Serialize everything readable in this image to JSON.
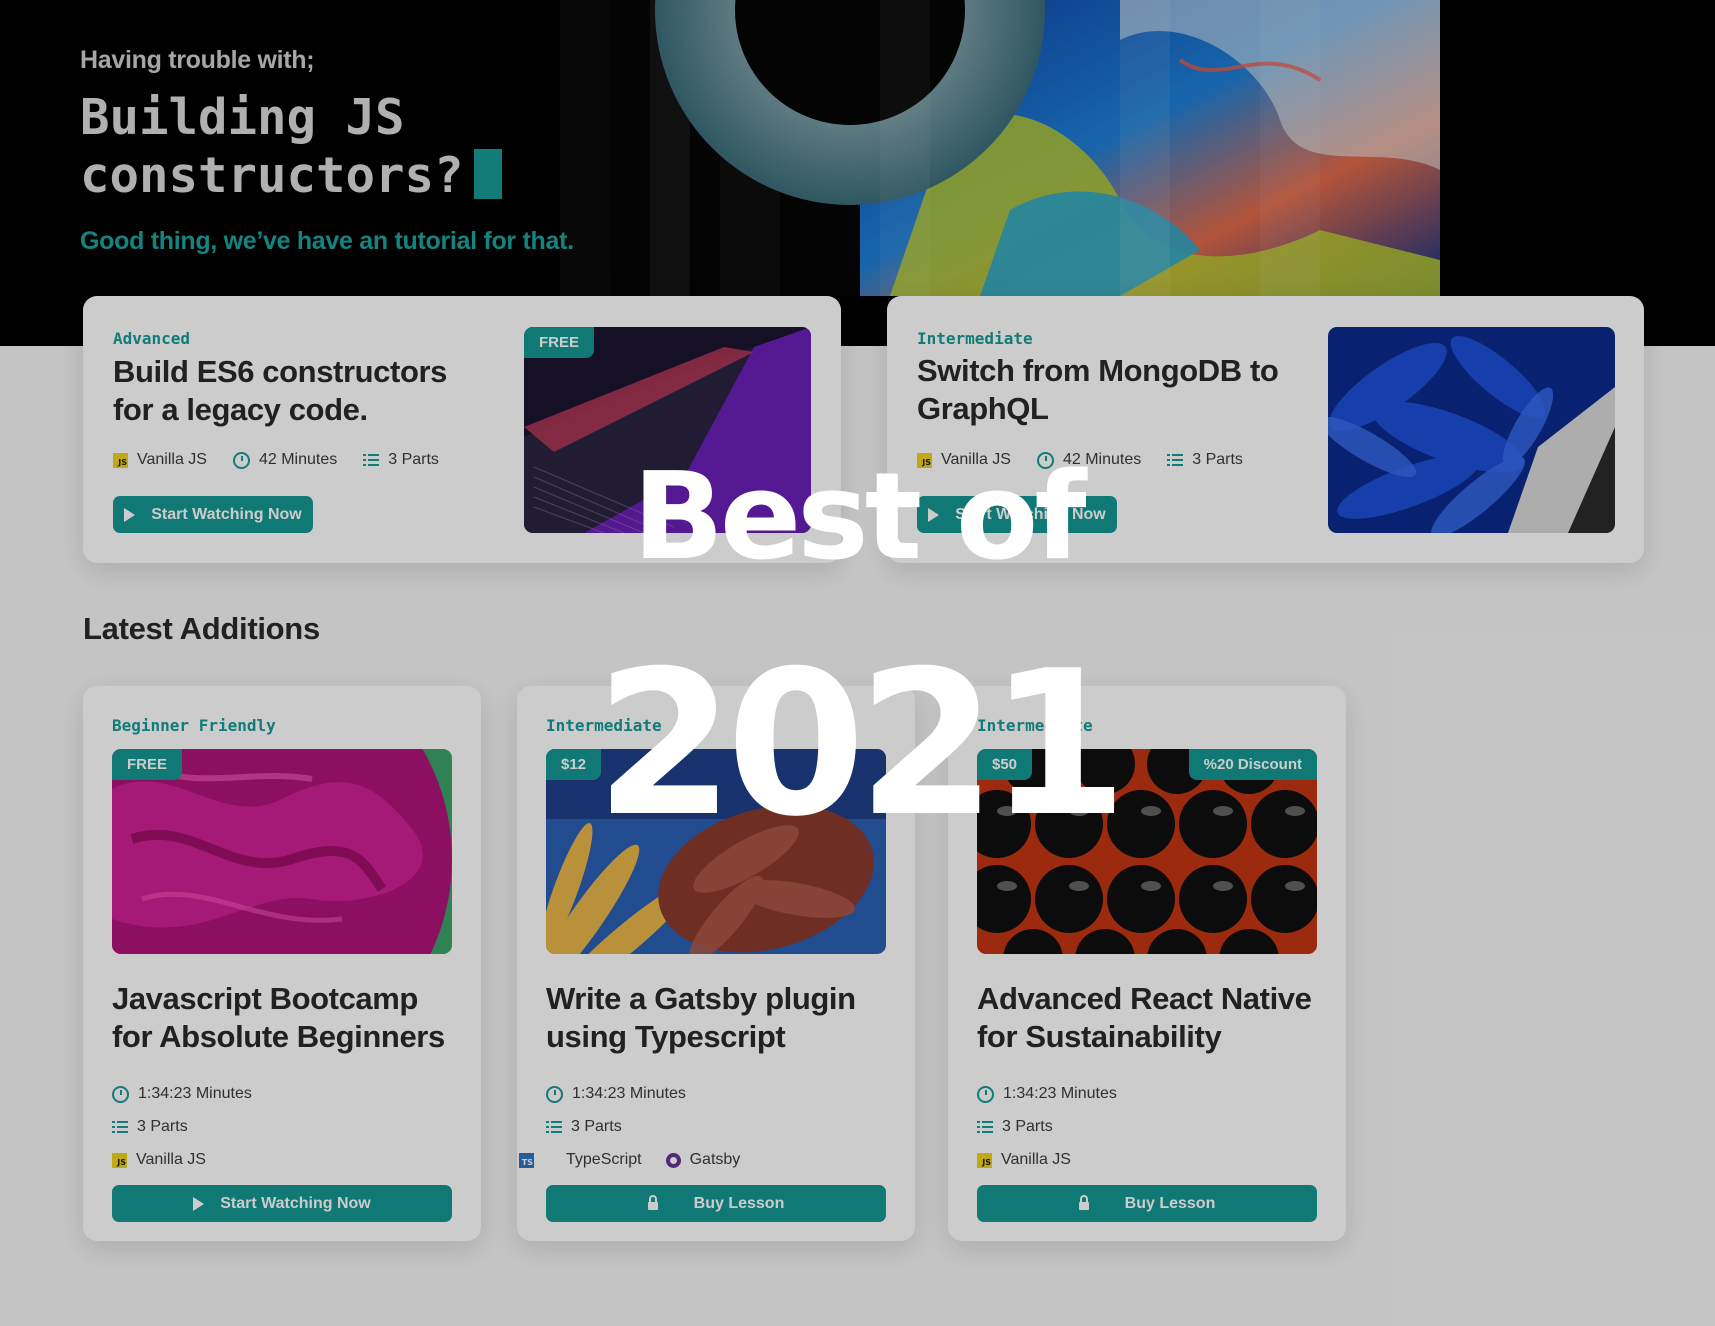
{
  "hero": {
    "subtitle": "Having trouble with;",
    "title_line1": "Building JS",
    "title_line2": "constructors?",
    "tagline": "Good thing, we’ve have an tutorial for that."
  },
  "featured": [
    {
      "level": "Advanced",
      "title_line1": "Build ES6 constructors",
      "title_line2": "for a legacy code.",
      "tech": "Vanilla JS",
      "duration": "42 Minutes",
      "parts": "3 Parts",
      "badge": "FREE",
      "button": "Start Watching Now"
    },
    {
      "level": "Intermediate",
      "title_line1": "Switch from MongoDB to",
      "title_line2": "GraphQL",
      "tech": "Vanilla JS",
      "duration": "42 Minutes",
      "parts": "3 Parts",
      "button": "Start Watching Now"
    }
  ],
  "latest": {
    "heading": "Latest Additions",
    "cards": [
      {
        "level": "Beginner Friendly",
        "badge_left": "FREE",
        "title_line1": "Javascript Bootcamp",
        "title_line2": "for Absolute Beginners",
        "duration": "1:34:23 Minutes",
        "parts": "3 Parts",
        "tech": "Vanilla JS",
        "button": "Start Watching Now"
      },
      {
        "level": "Intermediate",
        "badge_left": "$12",
        "title_line1": "Write a Gatsby plugin",
        "title_line2": "using Typescript",
        "duration": "1:34:23 Minutes",
        "parts": "3 Parts",
        "tech": "TypeScript",
        "tech2": "Gatsby",
        "button": "Buy Lesson"
      },
      {
        "level": "Intermediate",
        "badge_left": "$50",
        "badge_right": "%20 Discount",
        "title_line1": "Advanced React Native",
        "title_line2": "for Sustainability",
        "duration": "1:34:23 Minutes",
        "parts": "3 Parts",
        "tech": "Vanilla JS",
        "button": "Buy Lesson"
      }
    ]
  },
  "overlay": {
    "line1": "Best of",
    "line2": "2021"
  },
  "icons": {
    "js": "JS",
    "ts": "TS"
  },
  "colors": {
    "accent": "#169893",
    "hero_bg": "#000000",
    "page_bg": "#f6f6f7",
    "js_badge": "#f2d21b",
    "ts_badge": "#2f74c0",
    "gatsby": "#663399"
  }
}
